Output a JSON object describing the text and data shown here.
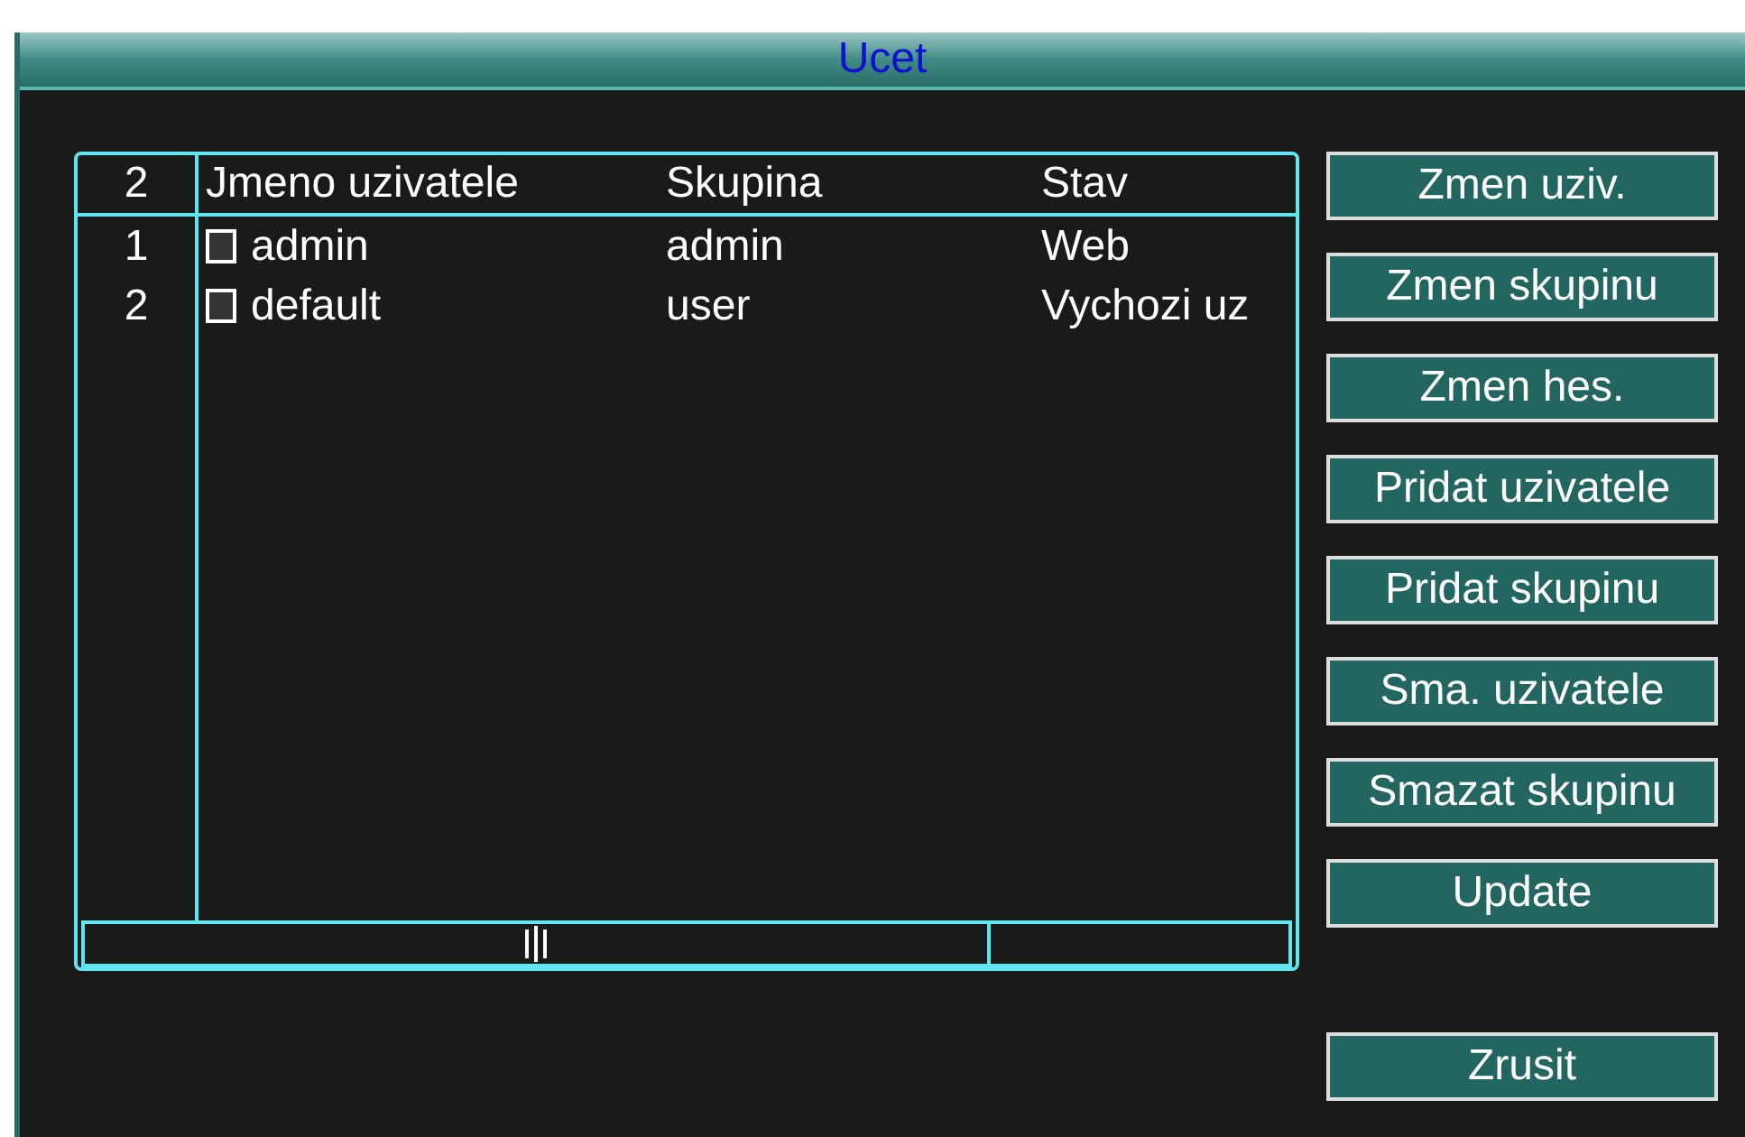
{
  "window": {
    "title": "Ucet"
  },
  "table": {
    "count": "2",
    "columns": [
      "Jmeno uzivatele",
      "Skupina",
      "Stav"
    ],
    "rows": [
      {
        "index": "1",
        "name": "admin",
        "group": "admin",
        "status": "Web",
        "checked": false
      },
      {
        "index": "2",
        "name": "default",
        "group": "user",
        "status": "Vychozi uz",
        "checked": false
      }
    ]
  },
  "buttons": [
    "Zmen uziv.",
    "Zmen skupinu",
    "Zmen hes.",
    "Pridat uzivatele",
    "Pridat skupinu",
    "Sma. uzivatele",
    "Smazat skupinu",
    "Update"
  ],
  "cancel_button": "Zrusit"
}
